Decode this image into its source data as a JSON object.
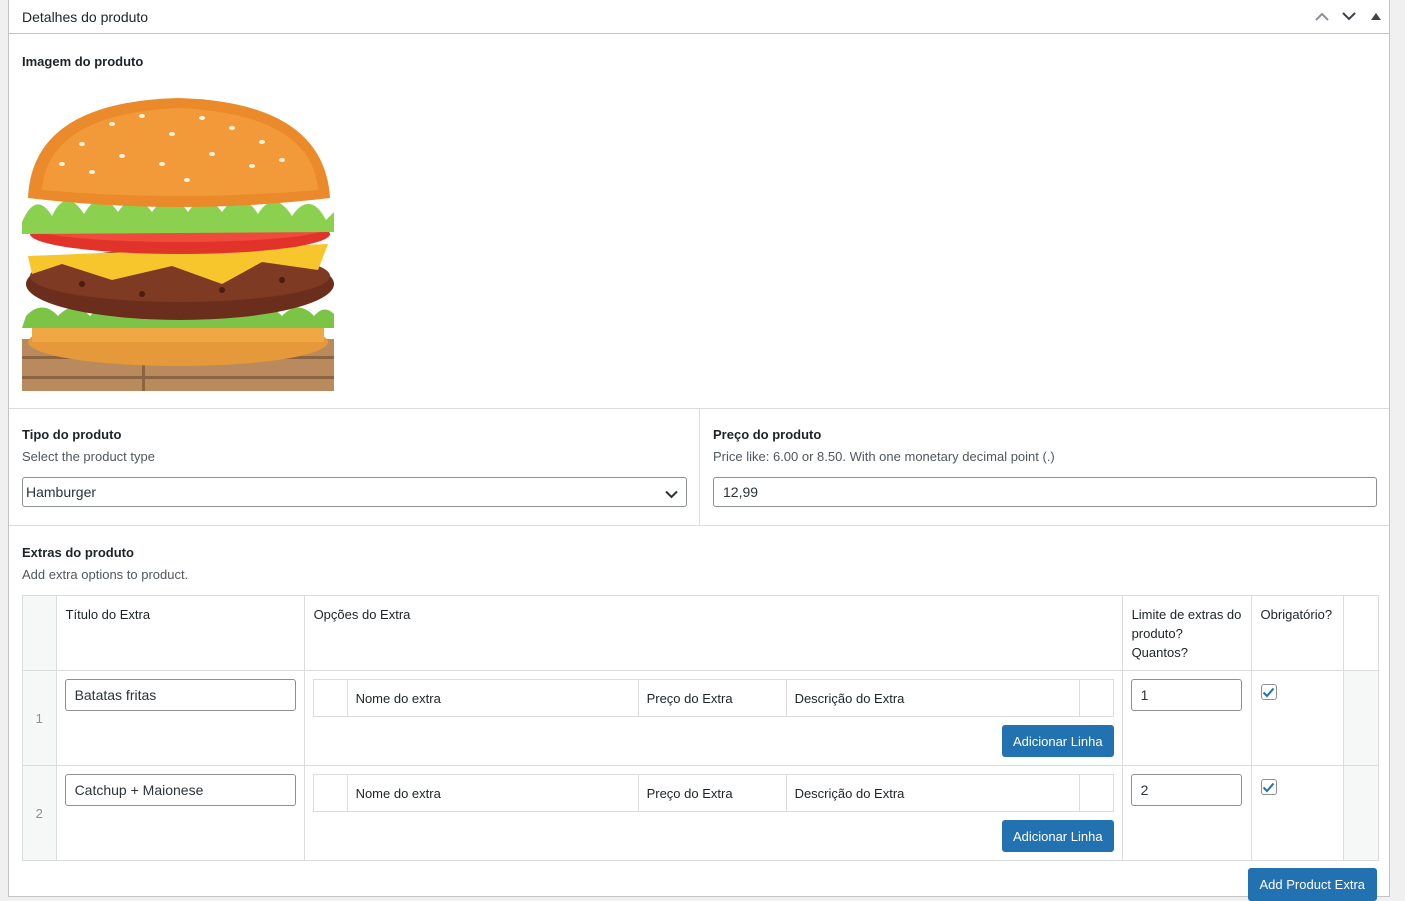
{
  "header": {
    "title": "Detalhes do produto",
    "icons": [
      "chevron-up-icon",
      "chevron-down-icon",
      "toggle-arrow-icon"
    ]
  },
  "image_section": {
    "label": "Imagem do produto"
  },
  "product_type": {
    "label": "Tipo do produto",
    "description": "Select the product type",
    "selected": "Hamburger"
  },
  "product_price": {
    "label": "Preço do produto",
    "description": "Price like: 6.00 or 8.50. With one monetary decimal point (.)",
    "value": "12,99"
  },
  "extras": {
    "label": "Extras do produto",
    "description": "Add extra options to product.",
    "columns": {
      "title": "Título do Extra",
      "options": "Opções do Extra",
      "limit": "Limite de extras do produto? Quantos?",
      "required": "Obrigatório?"
    },
    "sub_columns": {
      "name": "Nome do extra",
      "price": "Preço do Extra",
      "description": "Descrição do Extra"
    },
    "add_row_label": "Adicionar Linha",
    "rows": [
      {
        "index": "1",
        "title": "Batatas fritas",
        "limit": "1",
        "required": true
      },
      {
        "index": "2",
        "title": "Catchup + Maionese",
        "limit": "2",
        "required": true
      }
    ],
    "add_extra_label": "Add Product Extra"
  },
  "colors": {
    "primary": "#2271b1",
    "border": "#c3c4c7"
  }
}
